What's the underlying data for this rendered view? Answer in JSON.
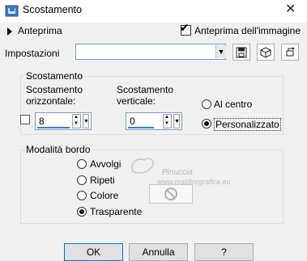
{
  "window": {
    "title": "Scostamento",
    "close_glyph": "✕"
  },
  "preview": {
    "label": "Anteprima",
    "image_preview_label": "Anteprima dell'immagine",
    "image_preview_checked": true
  },
  "settings": {
    "label": "Impostazioni",
    "value": ""
  },
  "offset_group": {
    "title": "Scostamento",
    "horizontal_label_1": "Scostamento",
    "horizontal_label_2": "orizzontale:",
    "horizontal_value": "8",
    "vertical_label_1": "Scostamento",
    "vertical_label_2": "verticale:",
    "vertical_value": "0",
    "center_label": "Al centro",
    "custom_label": "Personalizzato",
    "selected": "custom"
  },
  "edge_group": {
    "title": "Modalità bordo",
    "options": [
      "Avvolgi",
      "Ripeti",
      "Colore",
      "Trasparente"
    ],
    "selected": "Trasparente"
  },
  "watermark": {
    "name": "Pinuccia",
    "site": "www.maldiregrafica.eu"
  },
  "buttons": {
    "ok": "OK",
    "cancel": "Annulla",
    "help": "?"
  },
  "icons": [
    "app-icon",
    "close-icon",
    "expand-arrow-icon",
    "save-preset-icon",
    "load-preset-icon",
    "reset-icon",
    "no-color-icon"
  ],
  "colors": {
    "accent": "#0078d7",
    "focus_underline": "#3a7ad6",
    "background": "#f0f0f0"
  }
}
